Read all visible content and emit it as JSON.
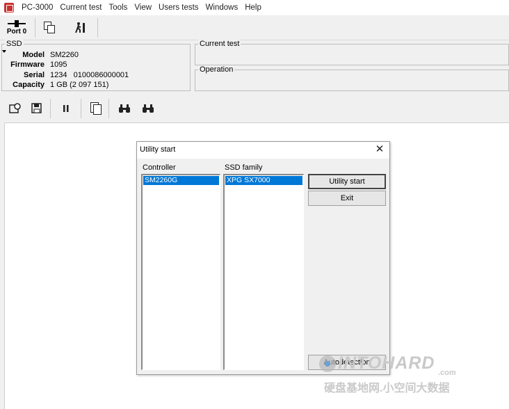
{
  "menu": {
    "app_title": "PC-3000",
    "items": [
      "Current test",
      "Tools",
      "View",
      "Users tests",
      "Windows",
      "Help"
    ]
  },
  "toolbar1": {
    "port_label": "Port 0",
    "icons": [
      "port-icon",
      "copy-windows-icon",
      "run-test-icon"
    ]
  },
  "ssd": {
    "group_title": "SSD",
    "model_label": "Model",
    "model_value": "SM2260",
    "firmware_label": "Firmware",
    "firmware_value": "1095",
    "serial_label": "Serial",
    "serial_value": "1234   0100086000001",
    "capacity_label": "Capacity",
    "capacity_value": "1 GB (2 097 151)"
  },
  "panels": {
    "current_test_title": "Current test",
    "operation_title": "Operation"
  },
  "toolbar2": {
    "icons": [
      "chip-settings-icon",
      "save-chip-icon",
      "pause-icon",
      "copy-pages-icon",
      "find-icon",
      "find-next-icon"
    ]
  },
  "dialog": {
    "title": "Utility start",
    "controller_label": "Controller",
    "controller_selected": "SM2260G",
    "family_label": "SSD family",
    "family_selected": "XPG SX7000",
    "utility_start_button": "Utility start",
    "exit_button": "Exit",
    "autodetection_button": "Autodetection"
  },
  "watermark": {
    "logo": "INTOHARD",
    "domain": ".com",
    "chinese": "硬盘基地网.小空间大数据"
  },
  "colors": {
    "selection": "#0078d7",
    "app_icon": "#c8332e"
  }
}
